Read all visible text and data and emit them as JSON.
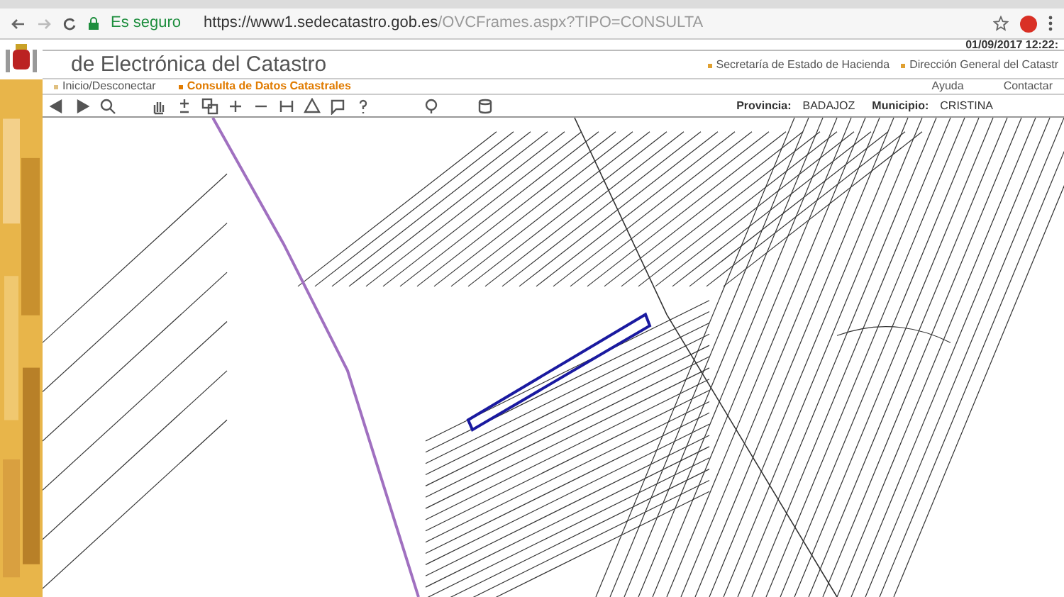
{
  "browser": {
    "secure_label": "Es seguro",
    "url_host": "https://www1.sedecatastro.gob.es",
    "url_path": "/OVCFrames.aspx?TIPO=CONSULTA"
  },
  "header": {
    "datetime": "01/09/2017 12:22:",
    "title": "de Electrónica del Catastro",
    "org_links": [
      "Secretaría de Estado de Hacienda",
      "Dirección General del Catastr"
    ]
  },
  "nav": {
    "items": [
      {
        "label": "Inicio/Desconectar",
        "selected": false
      },
      {
        "label": "Consulta de Datos Catastrales",
        "selected": true
      }
    ],
    "right_links": [
      "Ayuda",
      "Contactar"
    ]
  },
  "toolbar": {
    "provincia_label": "Provincia:",
    "provincia": "BADAJOZ",
    "municipio_label": "Municipio:",
    "municipio": "CRISTINA"
  }
}
